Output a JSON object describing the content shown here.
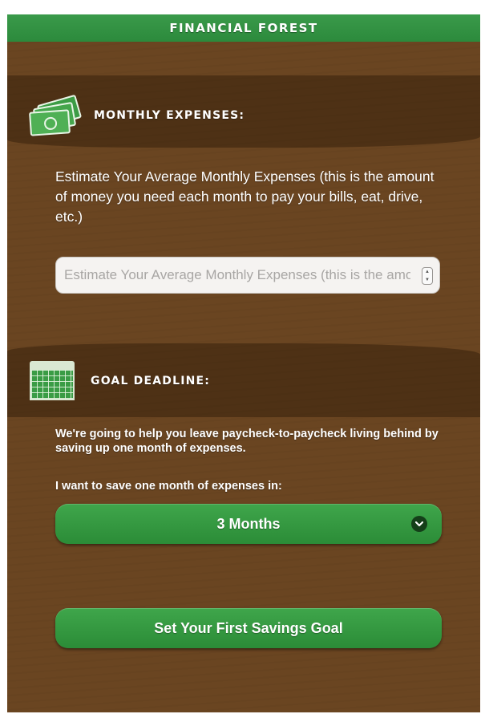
{
  "app": {
    "title": "FINANCIAL FOREST"
  },
  "expenses": {
    "icon": "money-icon",
    "title": "MONTHLY EXPENSES:",
    "description": "Estimate Your Average Monthly Expenses (this is the amount of money you need each month to pay your bills, eat, drive, etc.)",
    "input": {
      "placeholder": "Estimate Your Average Monthly Expenses (this is the amount of money you need each month to pay your bills, eat, drive, etc.)",
      "value": ""
    }
  },
  "goal": {
    "icon": "calendar-icon",
    "title": "GOAL DEADLINE:",
    "description": "We're going to help you leave paycheck-to-paycheck living behind by saving up one month of expenses.",
    "save_label": "I want to save one month of expenses in:",
    "selected_option": "3 Months"
  },
  "actions": {
    "submit_label": "Set Your First Savings Goal"
  },
  "colors": {
    "header_green": "#2f8f3f",
    "soil_brown": "#6a4521",
    "dark_band": "#4e3115",
    "button_green": "#35993f"
  }
}
